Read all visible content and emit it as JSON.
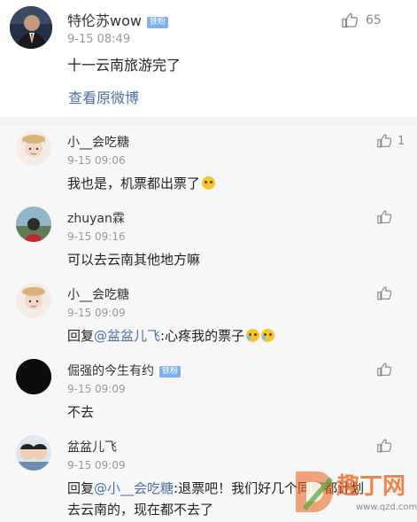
{
  "post": {
    "author": "特伦苏wow",
    "badge": "铁粉",
    "time": "9-15 08:49",
    "text": "十一云南旅游完了",
    "view_original": "查看原微博",
    "likes": "65"
  },
  "comments": [
    {
      "author": "小__会吃糖",
      "time": "9-15 09:06",
      "text": "我也是，机票都出票了",
      "likes": "1"
    },
    {
      "author": "zhuyan霖",
      "time": "9-15 09:16",
      "text": "可以去云南其他地方嘛",
      "likes": ""
    },
    {
      "author": "小__会吃糖",
      "time": "9-15 09:09",
      "reply_prefix": "回复",
      "mention": "@盆盆儿飞",
      "text": ":心疼我的票子",
      "likes": ""
    },
    {
      "author": "倔强的今生有约",
      "badge": "铁粉",
      "time": "9-15 09:09",
      "text": "不去",
      "likes": ""
    },
    {
      "author": "盆盆儿飞",
      "time": "9-15 09:09",
      "reply_prefix": "回复",
      "mention": "@小__会吃糖",
      "text": ":退票吧！我们好几个同事都计划",
      "text_line2": "去云南的，现在都不去了",
      "likes": ""
    }
  ],
  "watermark": {
    "text": "趣丁网",
    "url": "www.qzd.com"
  },
  "colors": {
    "link": "#4f6fa1",
    "badge": "#7fb0ea",
    "comment_bg": "#f7f7f7"
  }
}
